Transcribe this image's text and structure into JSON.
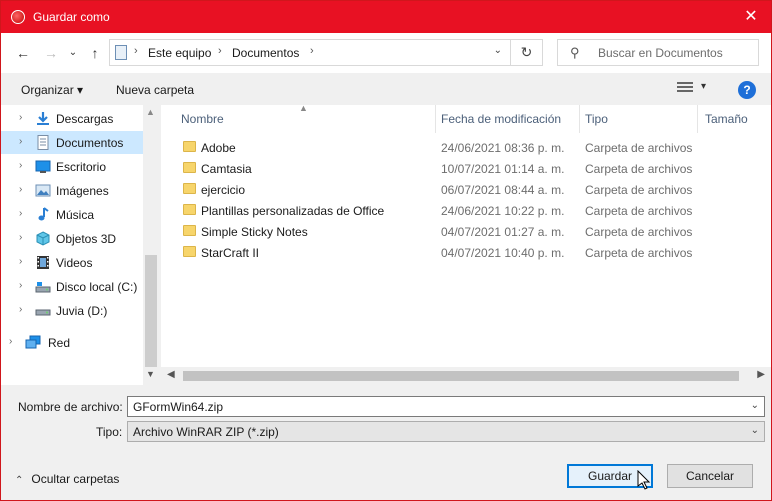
{
  "window": {
    "title": "Guardar como",
    "close_glyph": "✕"
  },
  "nav_buttons": {
    "back": "←",
    "forward": "→",
    "up": "↑",
    "recent": "⌄"
  },
  "address": {
    "crumbs": [
      "Este equipo",
      "Documentos"
    ],
    "separator": "›",
    "dropdown_glyph": "⌄",
    "refresh_glyph": "↻"
  },
  "search": {
    "placeholder": "Buscar en Documentos",
    "icon_glyph": "⚲"
  },
  "toolbar": {
    "organize_label": "Organizar ▾",
    "new_folder_label": "Nueva carpeta",
    "view_dropdown_glyph": "▾",
    "help_label": "?"
  },
  "nav_pane": {
    "items": [
      {
        "label": "Descargas",
        "icon": "download-icon",
        "selected": false
      },
      {
        "label": "Documentos",
        "icon": "documents-icon",
        "selected": true
      },
      {
        "label": "Escritorio",
        "icon": "desktop-icon",
        "selected": false
      },
      {
        "label": "Imágenes",
        "icon": "pictures-icon",
        "selected": false
      },
      {
        "label": "Música",
        "icon": "music-icon",
        "selected": false
      },
      {
        "label": "Objetos 3D",
        "icon": "3d-objects-icon",
        "selected": false
      },
      {
        "label": "Videos",
        "icon": "videos-icon",
        "selected": false
      },
      {
        "label": "Disco local (C:)",
        "icon": "drive-icon",
        "selected": false
      },
      {
        "label": "Juvia (D:)",
        "icon": "drive-icon",
        "selected": false
      },
      {
        "label": "Red",
        "icon": "network-icon",
        "selected": false
      }
    ],
    "chevron_glyph": "›"
  },
  "file_list": {
    "columns": [
      "Nombre",
      "Fecha de modificación",
      "Tipo",
      "Tamaño"
    ],
    "rows": [
      {
        "name": "Adobe",
        "date": "24/06/2021 08:36 p. m.",
        "type": "Carpeta de archivos"
      },
      {
        "name": "Camtasia",
        "date": "10/07/2021 01:14 a. m.",
        "type": "Carpeta de archivos"
      },
      {
        "name": "ejercicio",
        "date": "06/07/2021 08:44 a. m.",
        "type": "Carpeta de archivos"
      },
      {
        "name": "Plantillas personalizadas de Office",
        "date": "24/06/2021 10:22 p. m.",
        "type": "Carpeta de archivos"
      },
      {
        "name": "Simple Sticky Notes",
        "date": "04/07/2021 01:27 a. m.",
        "type": "Carpeta de archivos"
      },
      {
        "name": "StarCraft II",
        "date": "04/07/2021 10:40 p. m.",
        "type": "Carpeta de archivos"
      }
    ]
  },
  "form": {
    "filename_label": "Nombre de archivo:",
    "filename_value": "GFormWin64.zip",
    "type_label": "Tipo:",
    "type_value": "Archivo WinRAR ZIP (*.zip)",
    "dropdown_glyph": "⌄"
  },
  "footer": {
    "hide_folders_label": "Ocultar carpetas",
    "hide_folders_glyph": "⌃",
    "save_label": "Guardar",
    "cancel_label": "Cancelar"
  },
  "colors": {
    "titlebar": "#e81123",
    "selection": "#cce8ff",
    "accent": "#0078d7"
  }
}
